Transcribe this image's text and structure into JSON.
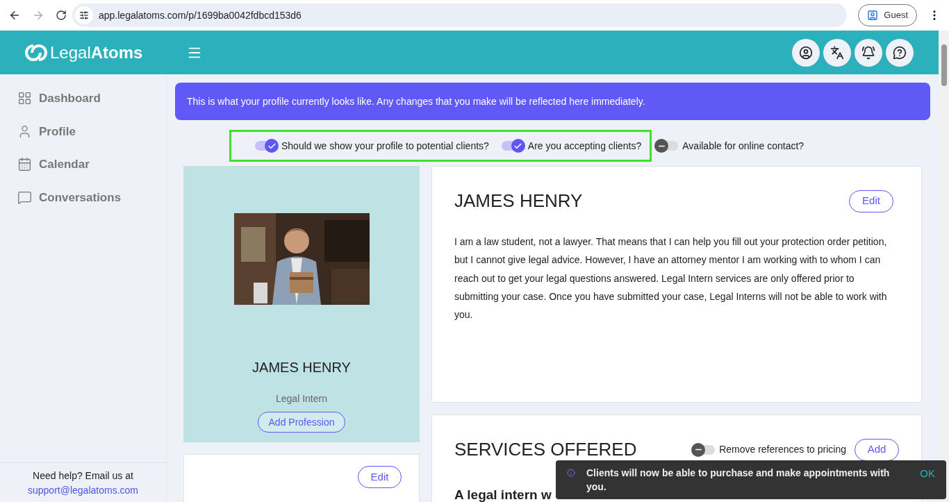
{
  "browser": {
    "url": "app.legalatoms.com/p/1699ba0042fdbcd153d6",
    "profile": "Guest"
  },
  "header": {
    "logo_light": "Legal",
    "logo_bold": "Atoms"
  },
  "sidebar": {
    "items": [
      {
        "label": "Dashboard",
        "selected": false
      },
      {
        "label": "Profile",
        "selected": false
      },
      {
        "label": "Calendar",
        "selected": false
      },
      {
        "label": "Conversations",
        "selected": false
      }
    ],
    "help_text": "Need help? Email us at",
    "help_link": "support@legalatoms.com"
  },
  "banner": "This is what your profile currently looks like. Any changes that you make will be reflected here immediately.",
  "highlighted_toggles": [
    {
      "label": "Should we show your profile to potential clients?",
      "on": true
    },
    {
      "label": "Are you accepting clients?",
      "on": true
    }
  ],
  "toggles": [
    {
      "label": "Available for online contact?",
      "on": false
    }
  ],
  "profile_card": {
    "name": "JAMES HENRY",
    "role": "Legal Intern",
    "add_button": "Add Profession"
  },
  "second_card": {
    "edit_button": "Edit"
  },
  "about": {
    "name": "JAMES HENRY",
    "edit_button": "Edit",
    "bio": "I am a law student, not a lawyer. That means that I can help you fill out your protection order petition, but I cannot give legal advice. However, I have an attorney mentor I am working with to whom I can reach out to get your legal questions answered. Legal Intern services are only offered prior to submitting your case. Once you have submitted your case, Legal Interns will not be able to work with you."
  },
  "services": {
    "title": "SERVICES OFFERED",
    "pricing_toggle": {
      "label": "Remove references to pricing",
      "on": false
    },
    "add_button": "Add",
    "first_item": "A legal intern w"
  },
  "toast": {
    "message": "Clients will now be able to purchase and make appointments with you.",
    "action": "OK"
  }
}
